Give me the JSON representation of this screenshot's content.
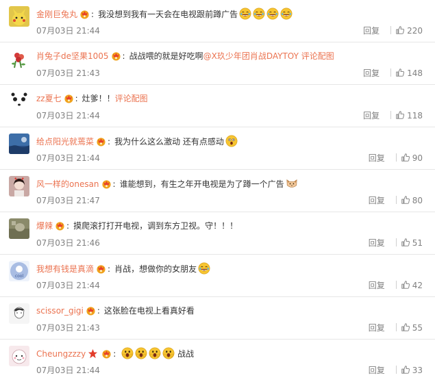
{
  "comments": [
    {
      "username": "金刚巨兔丸",
      "text": "我没想到我有一天会在电视跟前蹲广告",
      "link": "",
      "emojis": [
        "laugh",
        "laugh",
        "laugh",
        "laugh"
      ],
      "time": "07月03日 21:44",
      "reply": "回复",
      "likes": "220",
      "avatar_color": "#e2c64a",
      "avatar": "pikachu-avatar"
    },
    {
      "username": "肖兔子de坚果1005",
      "text": "战战喂的就是好吃啊",
      "link": "@X玖少年团肖战DAYTOY 评论配图",
      "emojis": [],
      "time": "07月03日 21:43",
      "reply": "回复",
      "likes": "148",
      "avatar_color": "#5a8a3a",
      "avatar": "flower-avatar"
    },
    {
      "username": "zz夏七",
      "text": "灶爹！！",
      "link": "评论配图",
      "emojis": [],
      "time": "07月03日 21:44",
      "reply": "回复",
      "likes": "118",
      "avatar_color": "#f4f4f4",
      "avatar": "panda-avatar"
    },
    {
      "username": "给点阳光就蔫菜",
      "text": "我为什么这么激动 还有点感动",
      "link": "",
      "emojis": [
        "surprised"
      ],
      "time": "07月03日 21:44",
      "reply": "回复",
      "likes": "90",
      "avatar_color": "#3d6ea8",
      "avatar": "sky-avatar"
    },
    {
      "username": "风一样的onesan",
      "text": "谁能想到，有生之年开电视是为了蹲一个广告",
      "link": "",
      "emojis": [
        "cat"
      ],
      "time": "07月03日 21:47",
      "reply": "回复",
      "likes": "80",
      "avatar_color": "#c9a8a4",
      "avatar": "girl-avatar"
    },
    {
      "username": "爆辣",
      "text": "摸爬滚打打开电视，调到东方卫视。守！！！",
      "link": "",
      "emojis": [],
      "time": "07月03日 21:46",
      "reply": "回复",
      "likes": "51",
      "avatar_color": "#8a8a6a",
      "avatar": "photo-avatar"
    },
    {
      "username": "我想有钱是真滴",
      "text": "肖战，想做你的女朋友",
      "link": "",
      "emojis": [
        "laugh"
      ],
      "time": "07月03日 21:44",
      "reply": "回复",
      "likes": "42",
      "avatar_color": "#9bb0d6",
      "avatar": "round-avatar"
    },
    {
      "username": "scissor_gigi",
      "text": "这张脸在电视上看真好看",
      "link": "",
      "emojis": [],
      "time": "07月03日 21:43",
      "reply": "回复",
      "likes": "55",
      "avatar_color": "#dcdcdc",
      "avatar": "sketch-avatar"
    },
    {
      "username": "Cheungzzzy",
      "text": "战战",
      "link": "",
      "emojis": [
        "scream",
        "scream",
        "scream",
        "scream"
      ],
      "star_badge": true,
      "time": "07月03日 21:44",
      "reply": "回复",
      "likes": "33",
      "avatar_color": "#f7e9ec",
      "avatar": "cartoon-avatar"
    }
  ]
}
